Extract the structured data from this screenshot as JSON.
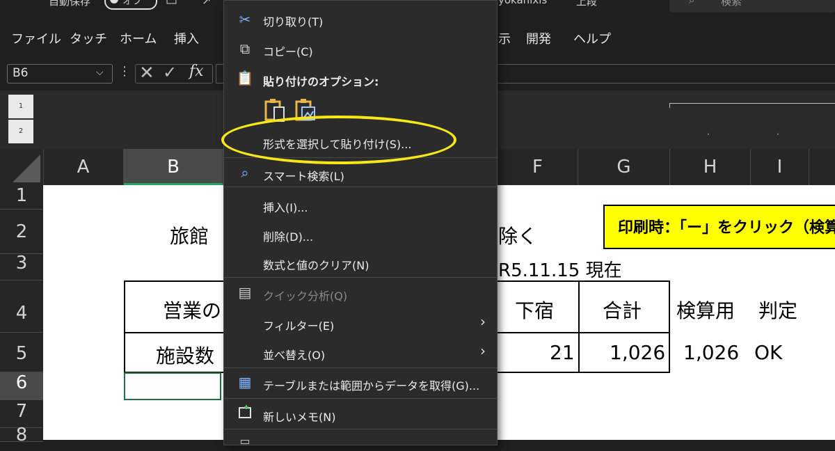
{
  "titlebar": {
    "autosave_label": "自動保存",
    "autosave_state": "オフ",
    "filename": "yokanixls",
    "saved_status": "上段",
    "search_placeholder": "検索"
  },
  "ribbon_tabs": [
    "ファイル",
    "タッチ",
    "ホーム",
    "挿入",
    "示",
    "開発",
    "ヘルプ"
  ],
  "formula_bar": {
    "name_box": "B6",
    "fx_label": "fx",
    "value": ""
  },
  "outline_levels": [
    "1",
    "2"
  ],
  "columns": [
    "A",
    "B",
    "F",
    "G",
    "H",
    "I"
  ],
  "rows": [
    "1",
    "2",
    "3",
    "4",
    "5",
    "6",
    "7",
    "8"
  ],
  "selected_cell": "B6",
  "sheet": {
    "title_left": "旅館",
    "title_right": "除く",
    "date_note": "R5.11.15 現在",
    "header_left": "営業の",
    "header_shimojuku": "下宿",
    "header_total": "合計",
    "header_check": "検算用",
    "header_judge": "判定",
    "row5_label": "施設数",
    "row5_shimojuku": "21",
    "row5_total": "1,026",
    "row5_check": "1,026",
    "row5_judge": "OK",
    "note_text": "印刷時：「ー」をクリック（検算"
  },
  "context_menu": {
    "cut": "切り取り(T)",
    "copy": "コピー(C)",
    "paste_options": "貼り付けのオプション:",
    "paste_special": "形式を選択して貼り付け(S)...",
    "smart_lookup": "スマート検索(L)",
    "insert": "挿入(I)...",
    "delete": "削除(D)...",
    "clear_contents": "数式と値のクリア(N)",
    "quick_analysis": "クイック分析(Q)",
    "filter": "フィルター(E)",
    "sort": "並べ替え(O)",
    "get_data": "テーブルまたは範囲からデータを取得(G)...",
    "new_note": "新しいメモ(N)"
  },
  "colors": {
    "highlight_ellipse": "#f5e71a",
    "note_fill": "#ffff00",
    "selection_green": "#1e7145"
  }
}
